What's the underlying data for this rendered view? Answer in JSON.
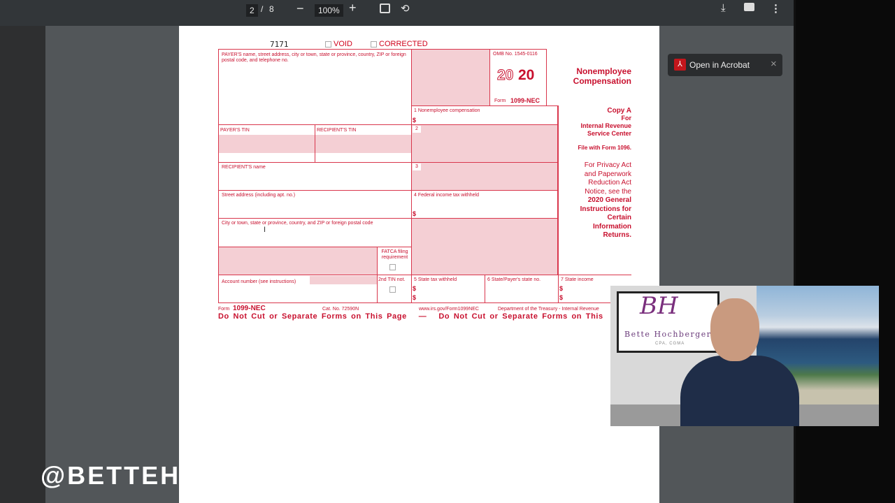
{
  "toolbar": {
    "page_current": "2",
    "page_sep": "/",
    "page_total": "8",
    "zoom_out": "−",
    "zoom": "100%",
    "zoom_in": "+",
    "icons": [
      "fit-page-icon",
      "rotate-icon",
      "download-icon",
      "print-icon",
      "more-icon"
    ]
  },
  "acrobat": {
    "label": "Open in Acrobat",
    "close": "×"
  },
  "form": {
    "code": "7171",
    "void": "VOID",
    "corrected": "CORRECTED",
    "payer_label": "PAYER'S name, street address, city or town, state or province, country, ZIP or foreign postal code, and telephone no.",
    "omb": "OMB No. 1545-0116",
    "year_outline": "20",
    "year_bold": "20",
    "form_prefix": "Form",
    "form_name": "1099-NEC",
    "title1": "Nonemployee",
    "title2": "Compensation",
    "box1": "1  Nonemployee compensation",
    "box2": "2",
    "box3": "3",
    "box4": "4  Federal income tax withheld",
    "dollar": "$",
    "payer_tin": "PAYER'S TIN",
    "recipient_tin": "RECIPIENT'S TIN",
    "recipient_name": "RECIPIENT'S name",
    "street": "Street address (including apt. no.)",
    "city": "City or town, state or province, country, and ZIP or foreign postal code",
    "fatca": "FATCA filing requirement",
    "account": "Account number (see instructions)",
    "tin2": "2nd TIN not.",
    "box5": "5  State tax withheld",
    "box6": "6  State/Payer's state no.",
    "box7": "7  State income",
    "copy_a": "Copy A",
    "for": "For",
    "irs1": "Internal Revenue",
    "irs2": "Service Center",
    "file_with": "File with Form 1096.",
    "privacy": [
      "For Privacy Act",
      "and Paperwork",
      "Reduction Act",
      "Notice, see the"
    ],
    "privacy_bold": [
      "2020 General",
      "Instructions for",
      "Certain",
      "Information",
      "Returns."
    ],
    "footer_form": "Form",
    "footer_name": "1099-NEC",
    "cat": "Cat. No. 72590N",
    "url": "www.irs.gov/Form1099NEC",
    "dept": "Department of the Treasury - Internal Revenue",
    "do_not_cut": "Do Not Cut or Separate Forms on This Page   —   Do Not Cut or Separate Forms on This"
  },
  "webcam": {
    "logo_initials": "BH",
    "logo_name": "Bette Hochberger",
    "logo_sub": "CPA, CGMA"
  },
  "watermark": "@BETTEH",
  "colors": {
    "form_red": "#c8102e",
    "form_pink": "#f4cfd4",
    "toolbar": "#323639",
    "viewer": "#525659"
  }
}
